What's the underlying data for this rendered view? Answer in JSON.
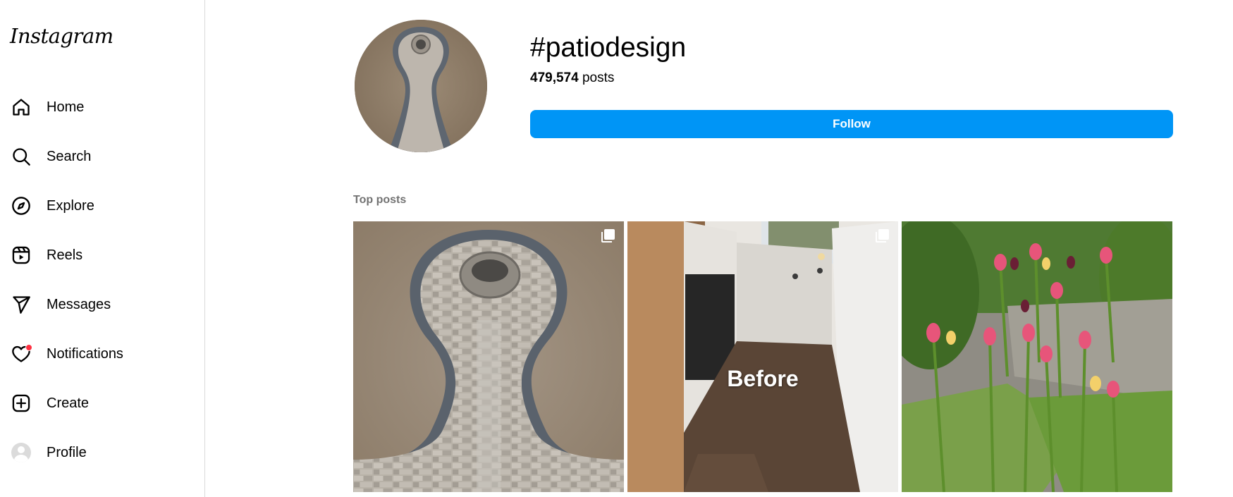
{
  "app": {
    "logo": "Instagram"
  },
  "sidebar": {
    "items": [
      {
        "label": "Home",
        "icon": "home-icon"
      },
      {
        "label": "Search",
        "icon": "search-icon"
      },
      {
        "label": "Explore",
        "icon": "compass-icon"
      },
      {
        "label": "Reels",
        "icon": "reels-icon"
      },
      {
        "label": "Messages",
        "icon": "send-icon"
      },
      {
        "label": "Notifications",
        "icon": "heart-icon"
      },
      {
        "label": "Create",
        "icon": "plus-square-icon"
      },
      {
        "label": "Profile",
        "icon": "avatar-icon"
      }
    ]
  },
  "header": {
    "hashtag": "#patiodesign",
    "post_count": "479,574",
    "post_count_suffix": " posts",
    "follow_label": "Follow"
  },
  "top_posts": {
    "title": "Top posts",
    "posts": [
      {
        "name": "paver-patio-fire-pit",
        "multi": true
      },
      {
        "name": "backyard-before",
        "multi": true,
        "overlay_text": "Before"
      },
      {
        "name": "tulips-garden",
        "multi": false
      }
    ]
  },
  "colors": {
    "accent": "#0095f6",
    "notification_dot": "#ff3040",
    "secondary_text": "#737373"
  }
}
